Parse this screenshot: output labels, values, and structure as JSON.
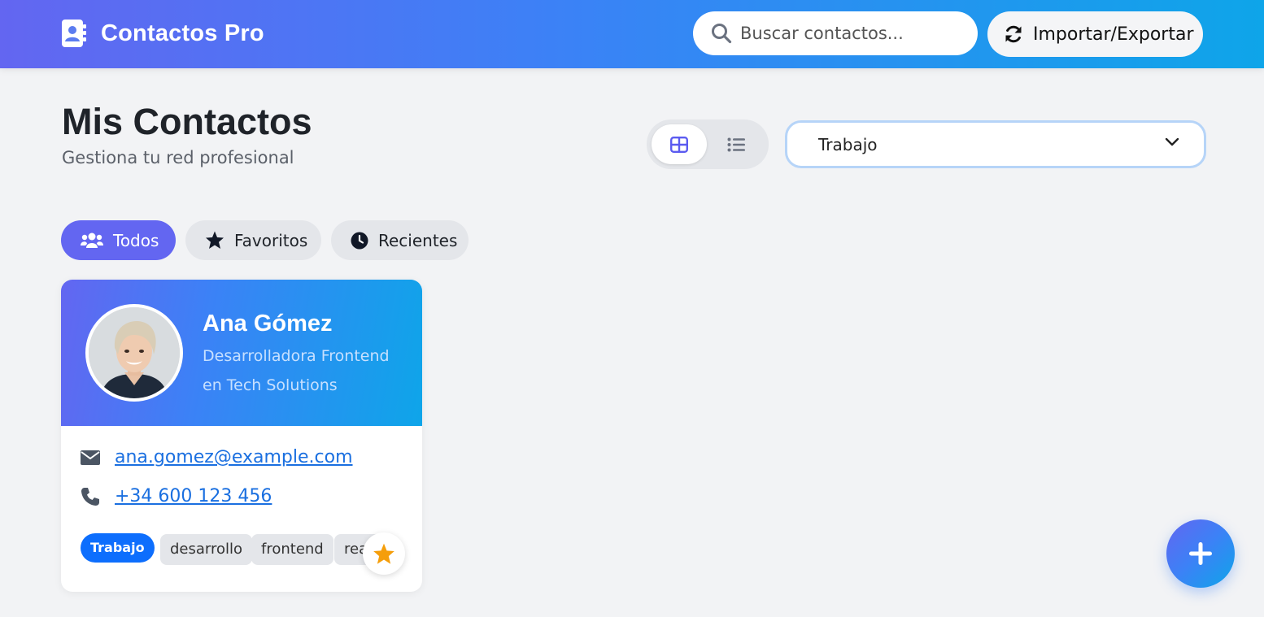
{
  "app": {
    "title": "Contactos Pro"
  },
  "header": {
    "search_placeholder": "Buscar contactos...",
    "import_export_label": "Importar/Exportar"
  },
  "page": {
    "title": "Mis Contactos",
    "subtitle": "Gestiona tu red profesional"
  },
  "filter": {
    "selected": "Trabajo"
  },
  "tabs": [
    {
      "label": "Todos",
      "icon": "users-icon",
      "active": true
    },
    {
      "label": "Favoritos",
      "icon": "star-icon",
      "active": false
    },
    {
      "label": "Recientes",
      "icon": "clock-icon",
      "active": false
    }
  ],
  "contacts": [
    {
      "name": "Ana Gómez",
      "role": "Desarrolladora Frontend en Tech Solutions",
      "email": "ana.gomez@example.com",
      "phone": "+34 600 123 456",
      "category": "Trabajo",
      "tags": [
        "desarrollo",
        "frontend",
        "react"
      ],
      "favorite": true
    }
  ],
  "colors": {
    "accent": "#6366f1",
    "brand_gradient_end": "#0ea5e9",
    "link": "#1a6fe0",
    "favorite_star": "#f59e0b",
    "category_badge": "#0d6efd"
  }
}
